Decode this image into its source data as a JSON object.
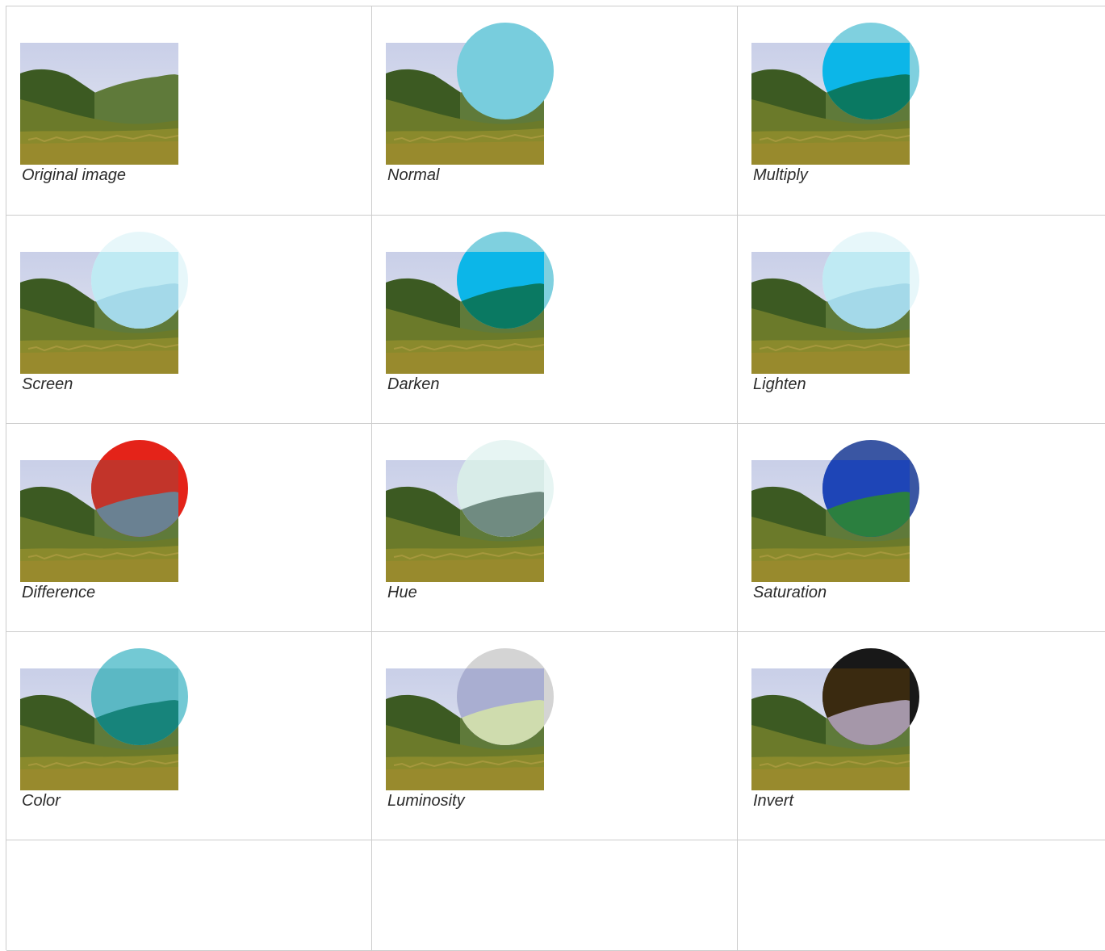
{
  "cells": [
    {
      "caption": "Original image",
      "mode": "original",
      "overlay_color": "",
      "blend_tint": ""
    },
    {
      "caption": "Normal",
      "mode": "normal",
      "overlay_color": "#78cddd",
      "blend_tint": ""
    },
    {
      "caption": "Multiply",
      "mode": "multiply",
      "overlay_color": "#78cddd",
      "blend_tint": "#0cb6e8"
    },
    {
      "caption": "Screen",
      "mode": "screen",
      "overlay_color": "#e6f7fa",
      "blend_tint": "#bfeaf3"
    },
    {
      "caption": "Darken",
      "mode": "darken",
      "overlay_color": "#78cddd",
      "blend_tint": "#0cb6e8"
    },
    {
      "caption": "Lighten",
      "mode": "lighten",
      "overlay_color": "#e6f7fa",
      "blend_tint": "#bfeaf3"
    },
    {
      "caption": "Difference",
      "mode": "difference",
      "overlay_color": "#e3170d",
      "blend_tint": "#c2342a"
    },
    {
      "caption": "Hue",
      "mode": "hue",
      "overlay_color": "#e6f4f2",
      "blend_tint": "#d8ece8"
    },
    {
      "caption": "Saturation",
      "mode": "saturation",
      "overlay_color": "#2f4d9e",
      "blend_tint": "#1e45b7"
    },
    {
      "caption": "Color",
      "mode": "color",
      "overlay_color": "#6cc6d2",
      "blend_tint": "#5bb8c4"
    },
    {
      "caption": "Luminosity",
      "mode": "luminosity",
      "overlay_color": "#d2d2d2",
      "blend_tint": "#a9aed1"
    },
    {
      "caption": "Invert",
      "mode": "invert",
      "overlay_color": "#0c0c0c",
      "blend_tint": "#3a2a10"
    },
    {
      "caption": "",
      "mode": "empty",
      "overlay_color": "",
      "blend_tint": ""
    },
    {
      "caption": "",
      "mode": "empty",
      "overlay_color": "",
      "blend_tint": ""
    },
    {
      "caption": "",
      "mode": "empty",
      "overlay_color": "",
      "blend_tint": ""
    }
  ]
}
